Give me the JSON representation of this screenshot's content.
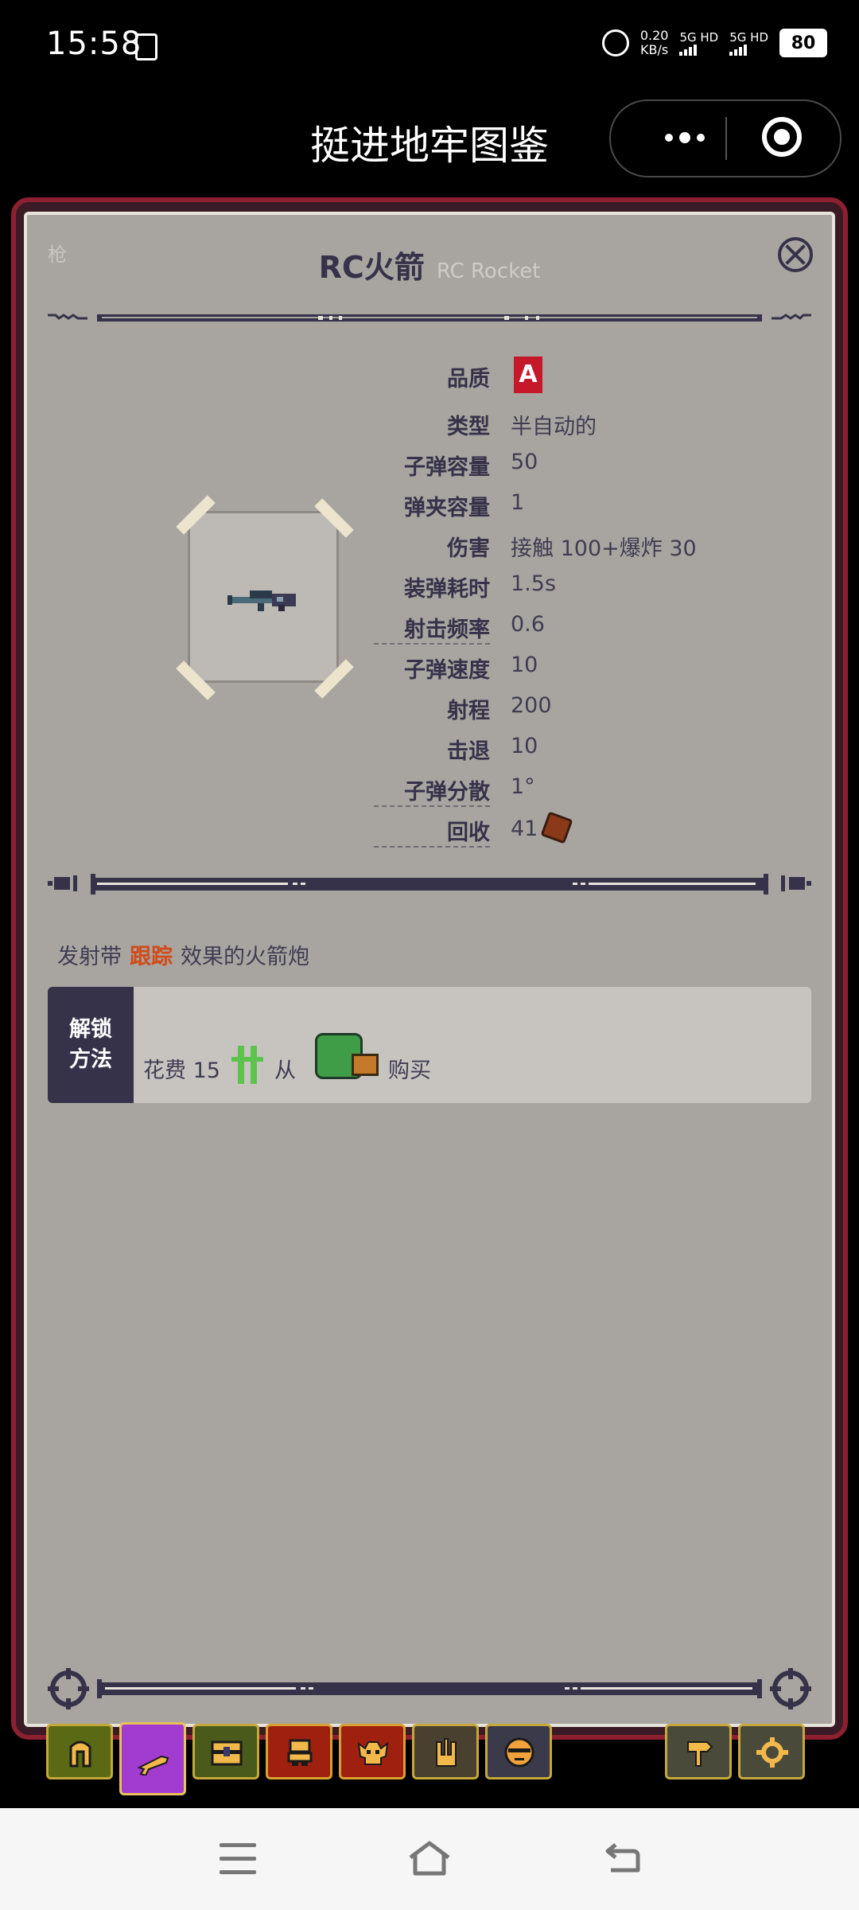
{
  "status_bar": {
    "time": "15:58",
    "net_speed_value": "0.20",
    "net_speed_unit": "KB/s",
    "sim1": "5G HD",
    "sim2": "5G HD",
    "battery": "80"
  },
  "app": {
    "title": "挺进地牢图鉴"
  },
  "item": {
    "category": "枪",
    "name_cn": "RC火箭",
    "name_en": "RC Rocket",
    "quality_badge": "A",
    "stats": [
      {
        "label": "品质",
        "value": ""
      },
      {
        "label": "类型",
        "value": "半自动的"
      },
      {
        "label": "子弹容量",
        "value": "50"
      },
      {
        "label": "弹夹容量",
        "value": "1"
      },
      {
        "label": "伤害",
        "value": "接触 100+爆炸 30"
      },
      {
        "label": "装弹耗时",
        "value": "1.5s"
      },
      {
        "label": "射击频率",
        "value": "0.6"
      },
      {
        "label": "子弹速度",
        "value": "10"
      },
      {
        "label": "射程",
        "value": "200"
      },
      {
        "label": "击退",
        "value": "10"
      },
      {
        "label": "子弹分散",
        "value": "1°"
      },
      {
        "label": "回收",
        "value": "41"
      }
    ],
    "description": {
      "before": "发射带",
      "highlight": "跟踪",
      "after": "效果的火箭炮"
    },
    "unlock": {
      "header_line1": "解锁",
      "header_line2": "方法",
      "cost_text": "花费 15",
      "from_text": "从",
      "buy_text": "购买"
    }
  },
  "colors": {
    "panel_bg": "#a8a5a0",
    "frame_border": "#8c2030",
    "ink": "#35324a",
    "highlight": "#d04a1a",
    "quality": "#c51828",
    "active_tab": "#a23bd0"
  },
  "tabs": [
    {
      "icon": "helmet-icon",
      "active": false
    },
    {
      "icon": "gun-icon",
      "active": true
    },
    {
      "icon": "chest-icon",
      "active": false
    },
    {
      "icon": "npc-icon",
      "active": false
    },
    {
      "icon": "enemy-skull-icon",
      "active": false
    },
    {
      "icon": "boss-throne-icon",
      "active": false
    },
    {
      "icon": "face-icon",
      "active": false
    },
    {
      "icon": "signpost-icon",
      "active": false
    },
    {
      "icon": "settings-gear-icon",
      "active": false
    }
  ]
}
